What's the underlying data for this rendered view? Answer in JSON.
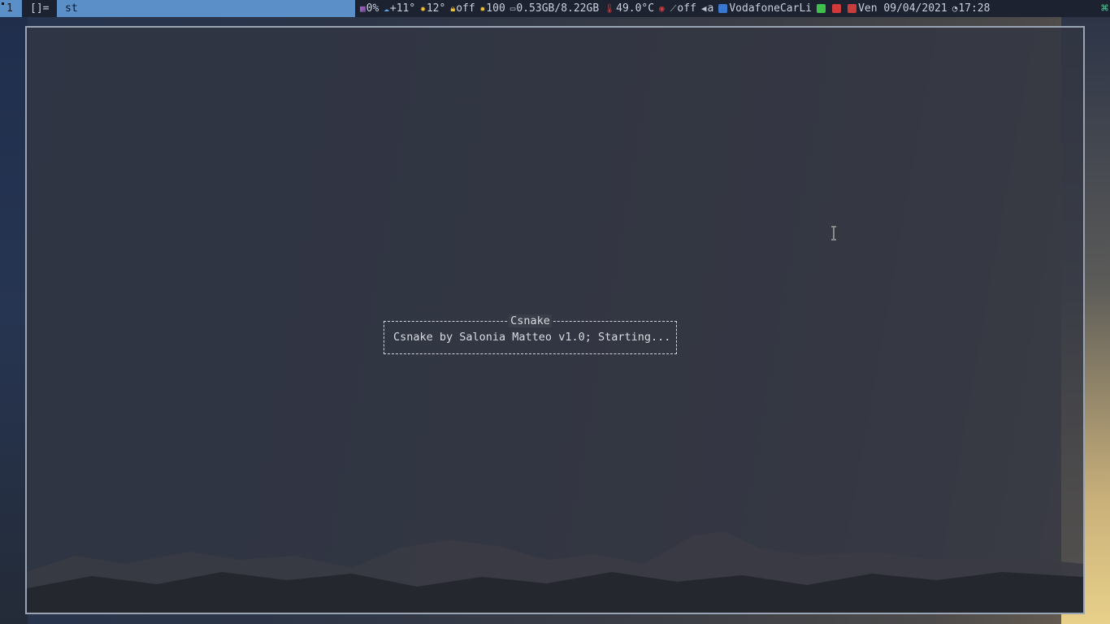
{
  "bar": {
    "tag_number": "1",
    "layout_symbol": "[]=",
    "window_title": "st",
    "status": {
      "cpu": "0%",
      "weather_temp": "+11°",
      "temp_alt": "12°",
      "lock": "off",
      "brightness": "100",
      "memory": "0.53GB/8.22GB",
      "cpu_temp": "49.0°C",
      "mic": "off",
      "keyboard": "a",
      "wifi": "VodafoneCarLi",
      "date": "Ven 09/04/2021",
      "time": "17:28"
    }
  },
  "terminal": {
    "dialog_title": "Csnake",
    "dialog_message": "Csnake by Salonia Matteo v1.0; Starting..."
  },
  "icons": {
    "cpu": "cpu-icon",
    "weather": "weather-icon",
    "sun": "sun-icon",
    "lock": "lock-icon",
    "brightness": "brightness-icon",
    "memory": "memory-icon",
    "thermometer": "thermometer-icon",
    "volume": "volume-muted-icon",
    "mic": "microphone-icon",
    "keyboard": "keyboard-icon",
    "wifi": "wifi-icon",
    "battery": "battery-icon",
    "calendar": "calendar-icon",
    "clock": "clock-icon",
    "corner": "cloverleaf-icon"
  },
  "colors": {
    "accent": "#5a8fc8",
    "bar_bg": "#1c2230",
    "window_border": "#9aa4b2"
  }
}
